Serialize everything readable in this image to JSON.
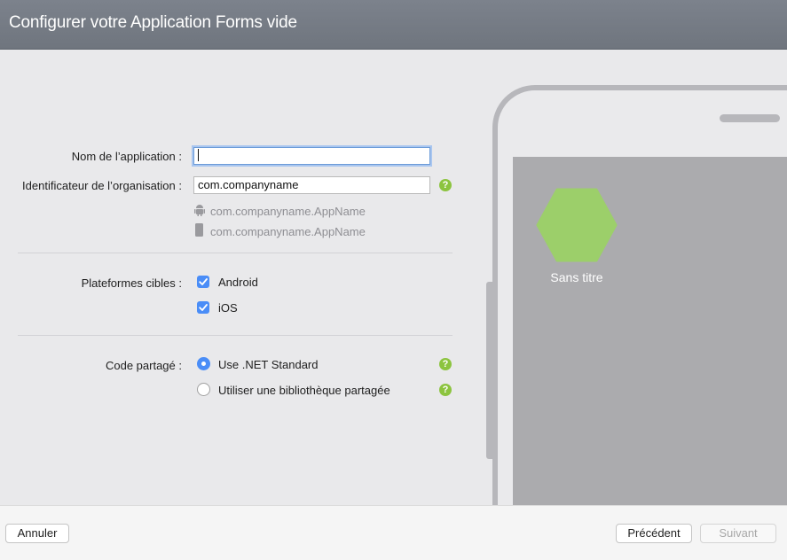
{
  "header": {
    "title": "Configurer votre Application Forms vide"
  },
  "form": {
    "app_name_label": "Nom de l’application :",
    "app_name_value": "",
    "org_id_label": "Identificateur de l’organisation :",
    "org_id_value": "com.companyname",
    "android_bundle": "com.companyname.AppName",
    "ios_bundle": "com.companyname.AppName",
    "platforms_label": "Plateformes cibles :",
    "platform_android": "Android",
    "platform_ios": "iOS",
    "shared_code_label": "Code partagé :",
    "option_net_standard": "Use .NET Standard",
    "option_shared_library": "Utiliser une bibliothèque partagée",
    "help_glyph": "?"
  },
  "preview": {
    "app_title": "Sans titre"
  },
  "footer": {
    "cancel_label": "Annuler",
    "previous_label": "Précédent",
    "next_label": "Suivant"
  },
  "colors": {
    "accent": "#4a8df7",
    "help": "#8cc43f",
    "app_icon": "#9ccf6a"
  },
  "state": {
    "android_checked": true,
    "ios_checked": true,
    "shared_code_selected": "net_standard"
  }
}
